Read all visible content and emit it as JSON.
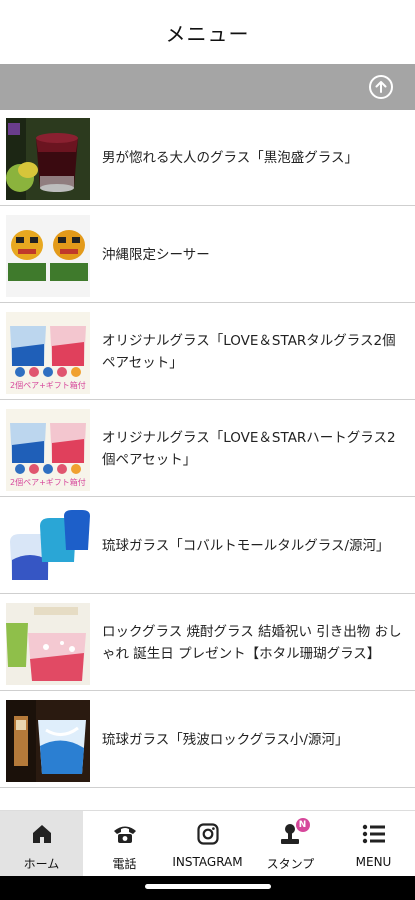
{
  "header": {
    "title": "メニュー"
  },
  "top_bar": {
    "icon": "upload-circle-icon"
  },
  "menu_items": [
    {
      "label": "男が惚れる大人のグラス「黒泡盛グラス」"
    },
    {
      "label": "沖縄限定シーサー"
    },
    {
      "label": "オリジナルグラス「LOVE＆STARタルグラス2個ペアセット」",
      "badge": "2個ペア+ギフト箱付"
    },
    {
      "label": "オリジナルグラス「LOVE＆STARハートグラス2個ペアセット」",
      "badge": "2個ペア+ギフト箱付"
    },
    {
      "label": "琉球ガラス「コバルトモールタルグラス/源河」"
    },
    {
      "label": "ロックグラス 焼酎グラス 結婚祝い 引き出物 おしゃれ 誕生日 プレゼント【ホタル珊瑚グラス】"
    },
    {
      "label": "琉球ガラス「残波ロックグラス小/源河」"
    }
  ],
  "tabbar": {
    "tabs": [
      {
        "label": "ホーム",
        "icon": "home-icon"
      },
      {
        "label": "電話",
        "icon": "phone-icon"
      },
      {
        "label": "INSTAGRAM",
        "icon": "instagram-icon"
      },
      {
        "label": "スタンプ",
        "icon": "stamp-icon",
        "badge": "N"
      },
      {
        "label": "MENU",
        "icon": "menu-list-icon"
      }
    ]
  },
  "colors": {
    "top_bar": "#a5a5a5",
    "active_tab": "#e3e3e3",
    "badge": "#d6479b",
    "home_indicator_bg": "#000000"
  }
}
